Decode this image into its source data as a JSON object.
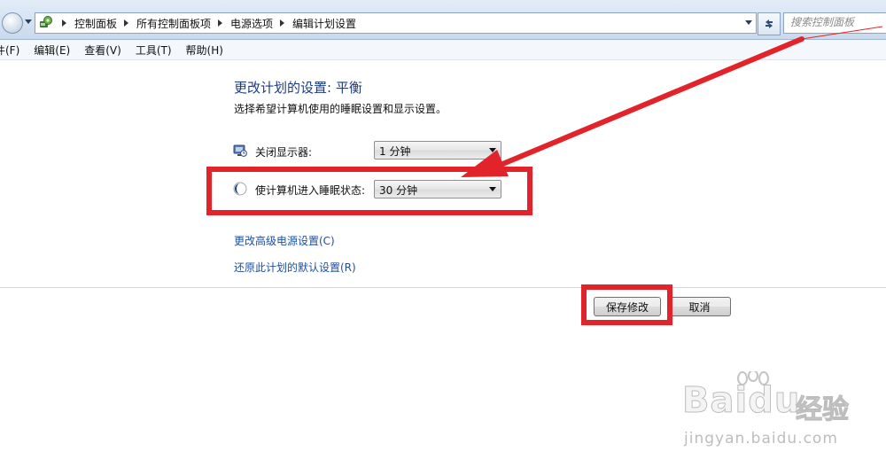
{
  "address_bar": {
    "icon": "control-panel-icon",
    "breadcrumbs": [
      "控制面板",
      "所有控制面板项",
      "电源选项",
      "编辑计划设置"
    ],
    "search_placeholder": "搜索控制面板"
  },
  "menu": {
    "items": [
      "件(F)",
      "编辑(E)",
      "查看(V)",
      "工具(T)",
      "帮助(H)"
    ]
  },
  "page": {
    "title": "更改计划的设置: 平衡",
    "subtitle": "选择希望计算机使用的睡眠设置和显示设置。",
    "settings": [
      {
        "label": "关闭显示器:",
        "value": "1 分钟",
        "icon": "monitor-icon"
      },
      {
        "label": "使计算机进入睡眠状态:",
        "value": "30 分钟",
        "icon": "sleep-moon-icon"
      }
    ],
    "links": [
      "更改高级电源设置(C)",
      "还原此计划的默认设置(R)"
    ],
    "buttons": {
      "save": "保存修改",
      "cancel": "取消"
    }
  },
  "colors": {
    "annotation": "#e2232a",
    "title": "#1d3b82",
    "link": "#1f4fa0"
  },
  "watermark": {
    "brand": "Baidu",
    "brand_cn": "经验",
    "url": "jingyan.baidu.com"
  }
}
